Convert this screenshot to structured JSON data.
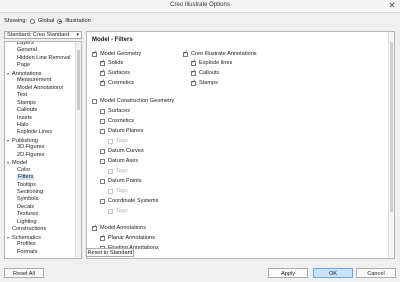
{
  "window": {
    "title": "Creo Illustrate Options",
    "close_glyph": "✕"
  },
  "showing": {
    "label": "Showing:",
    "options": [
      "Global",
      "Illustration"
    ],
    "selected": "Illustration"
  },
  "standard_select": {
    "value": "Standard: Creo Standard"
  },
  "tree": {
    "items": [
      {
        "label": "Layers",
        "level": 2
      },
      {
        "label": "General",
        "level": 2
      },
      {
        "label": "Hidden Line Removal",
        "level": 2
      },
      {
        "label": "Page",
        "level": 2
      },
      {
        "label": "Annotations",
        "level": 1,
        "toggle": "▾"
      },
      {
        "label": "Measurement",
        "level": 2
      },
      {
        "label": "Model Annotations",
        "level": 2
      },
      {
        "label": "Text",
        "level": 2
      },
      {
        "label": "Stamps",
        "level": 2
      },
      {
        "label": "Callouts",
        "level": 2
      },
      {
        "label": "Insets",
        "level": 2
      },
      {
        "label": "Halo",
        "level": 2
      },
      {
        "label": "Explode Lines",
        "level": 2
      },
      {
        "label": "Publishing",
        "level": 1,
        "toggle": "▾"
      },
      {
        "label": "3D Figures",
        "level": 2
      },
      {
        "label": "2D Figures",
        "level": 2
      },
      {
        "label": "Model",
        "level": 1,
        "toggle": "▾"
      },
      {
        "label": "Color",
        "level": 2
      },
      {
        "label": "Filters",
        "level": 2,
        "selected": true
      },
      {
        "label": "Tooltips",
        "level": 2
      },
      {
        "label": "Sectioning",
        "level": 2
      },
      {
        "label": "Symbols",
        "level": 2
      },
      {
        "label": "Decals",
        "level": 2
      },
      {
        "label": "Textures",
        "level": 2
      },
      {
        "label": "Lighting",
        "level": 2
      },
      {
        "label": "Constructions",
        "level": 1
      },
      {
        "label": "Schematics",
        "level": 1,
        "toggle": "▾"
      },
      {
        "label": "Profiles",
        "level": 2
      },
      {
        "label": "Formats",
        "level": 2
      }
    ]
  },
  "main": {
    "title": "Model - Filters",
    "model_geometry": {
      "label": "Model Geometry",
      "checked": true,
      "children": [
        {
          "label": "Solids",
          "checked": true
        },
        {
          "label": "Surfaces",
          "checked": true
        },
        {
          "label": "Cosmetics",
          "checked": true
        }
      ]
    },
    "illustrate_annotations": {
      "label": "Creo Illustrate Annotations",
      "checked": true,
      "children": [
        {
          "label": "Explode lines",
          "checked": true
        },
        {
          "label": "Callouts",
          "checked": true
        },
        {
          "label": "Stamps",
          "checked": true
        }
      ]
    },
    "construction_geometry": {
      "label": "Model Construction Geometry",
      "checked": false,
      "children": [
        {
          "label": "Surfaces",
          "checked": false
        },
        {
          "label": "Cosmetics",
          "checked": false
        },
        {
          "label": "Datum Planes",
          "checked": false,
          "tags": "Tags"
        },
        {
          "label": "Datum Curves",
          "checked": false
        },
        {
          "label": "Datum Axes",
          "checked": false,
          "tags": "Tags"
        },
        {
          "label": "Datum Points",
          "checked": false,
          "tags": "Tags"
        },
        {
          "label": "Coordinate Systems",
          "checked": false,
          "tags": "Tags"
        }
      ]
    },
    "model_annotations": {
      "label": "Model Annotations",
      "checked": true,
      "children": [
        {
          "label": "Planar Annotations",
          "checked": true
        },
        {
          "label": "Floating Annotations",
          "checked": false
        }
      ]
    }
  },
  "buttons": {
    "reset_standard": "Reset to Standard",
    "reset_all": "Reset All",
    "apply": "Apply",
    "ok": "OK",
    "cancel": "Cancel"
  }
}
